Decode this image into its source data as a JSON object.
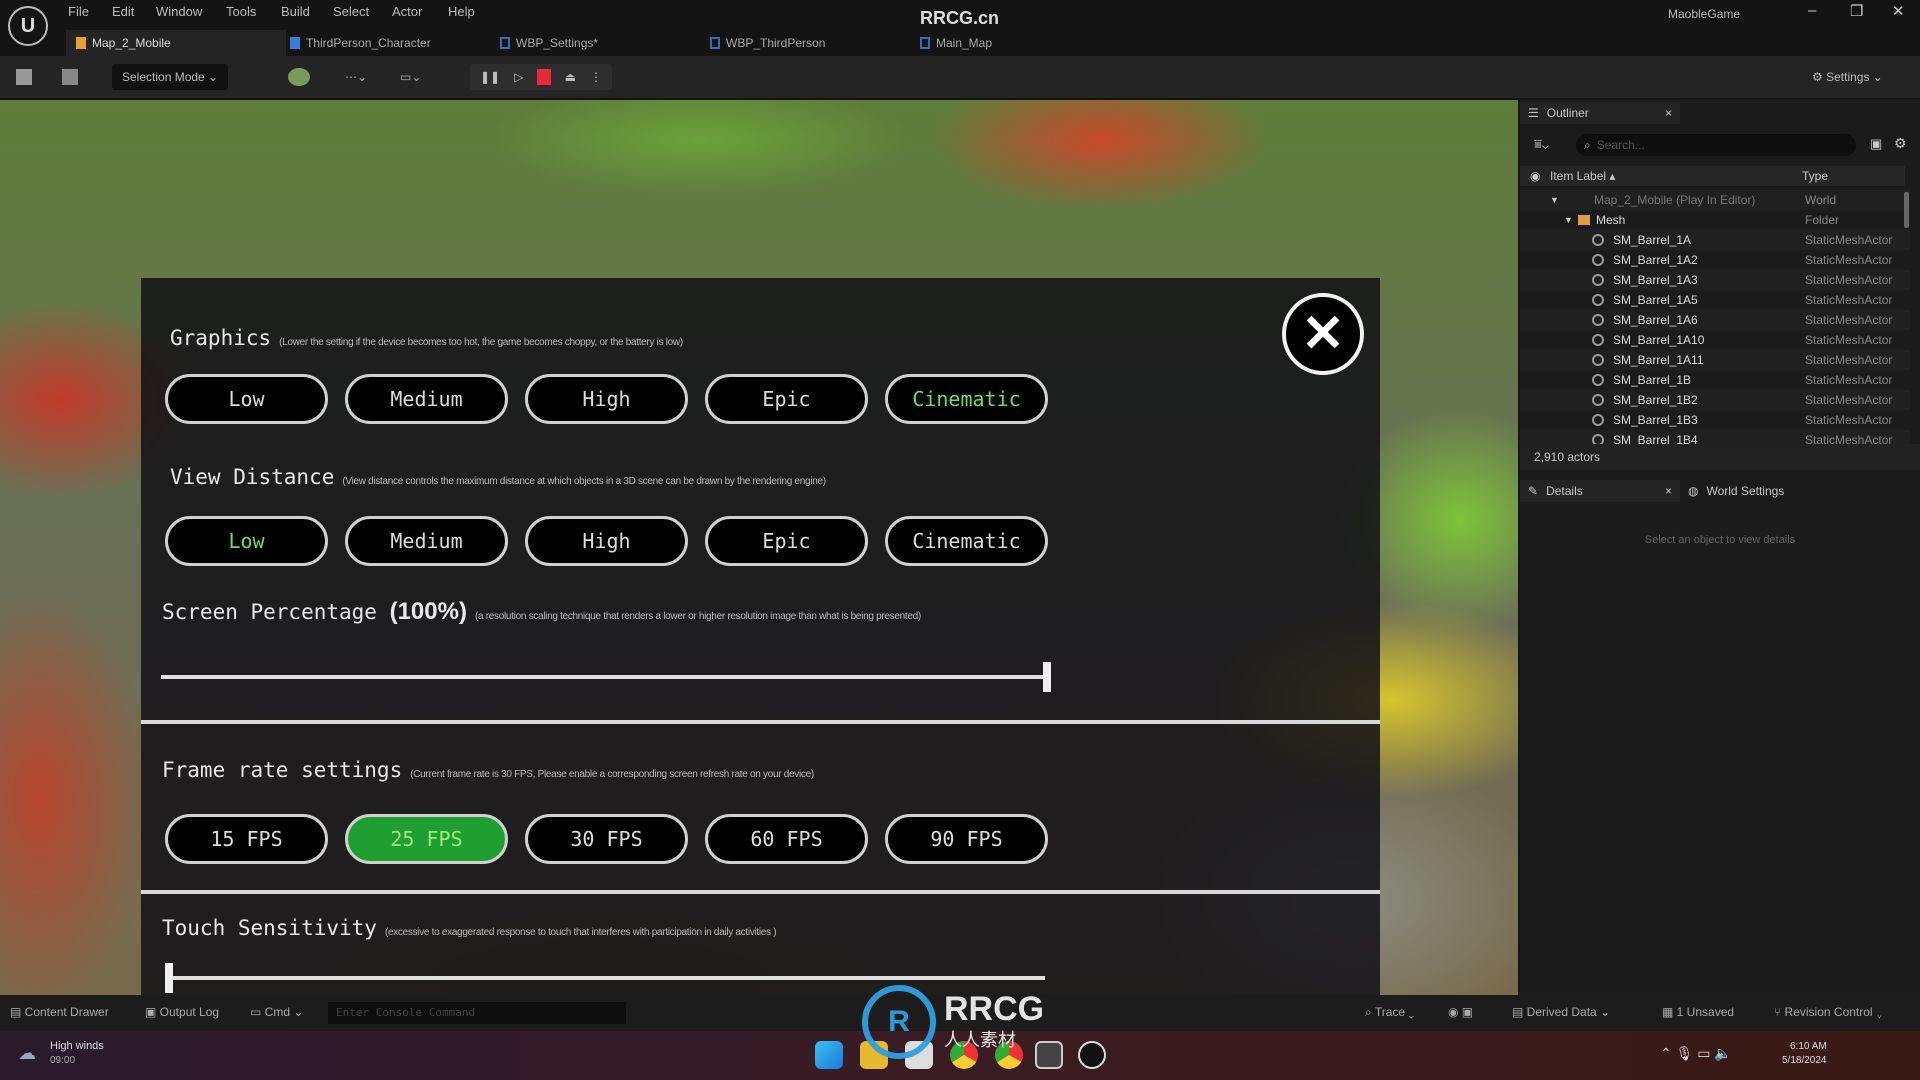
{
  "window": {
    "title": "RRCG.cn",
    "project": "MaobleGame",
    "minimize": "–",
    "restore": "❐",
    "close": "✕"
  },
  "menu": [
    "File",
    "Edit",
    "Window",
    "Tools",
    "Build",
    "Select",
    "Actor",
    "Help"
  ],
  "tabs": [
    {
      "label": "Map_2_Mobile",
      "active": true
    },
    {
      "label": "ThirdPerson_Character"
    },
    {
      "label": "WBP_Settings*"
    },
    {
      "label": "WBP_ThirdPerson"
    },
    {
      "label": "Main_Map"
    }
  ],
  "toolbar": {
    "selection_mode": "Selection Mode ⌄",
    "settings": "Settings ⌄"
  },
  "settings_menu": {
    "graphics": {
      "title": "Graphics",
      "note": "(Lower the setting if the device becomes too hot, the game becomes choppy, or the battery is low)",
      "options": [
        "Low",
        "Medium",
        "High",
        "Epic",
        "Cinematic"
      ],
      "selected": "Cinematic"
    },
    "view_distance": {
      "title": "View Distance",
      "note": "(View distance controls the maximum distance at which objects in a 3D scene can be drawn by the rendering engine)",
      "options": [
        "Low",
        "Medium",
        "High",
        "Epic",
        "Cinematic"
      ],
      "selected": "Low"
    },
    "screen_percentage": {
      "title": "Screen Percentage",
      "value_label": "(100%)",
      "note": "(a resolution scaling technique that renders a lower or higher resolution image than what is being presented)",
      "value": 1.0
    },
    "frame_rate": {
      "title": "Frame rate settings",
      "note": "(Current frame rate is 30 FPS, Please enable a corresponding screen refresh rate on your device)",
      "options": [
        "15 FPS",
        "25 FPS",
        "30 FPS",
        "60 FPS",
        "90 FPS"
      ],
      "selected": "25 FPS"
    },
    "touch_sensitivity": {
      "title": "Touch Sensitivity",
      "note": "(excessive to exaggerated response to touch that interferes with participation in daily activities )",
      "value": 0.0
    },
    "close_icon": "close-circle-icon",
    "selected_color": "#6be05a",
    "selected_fill": "#1f9e32"
  },
  "outliner": {
    "tab": "Outliner",
    "close": "×",
    "search_placeholder": "Search...",
    "col_label": "Item Label ▴",
    "col_type": "Type",
    "rows": [
      {
        "label": "Map_2_Mobile (Play In Editor)",
        "type": "World",
        "level": 0
      },
      {
        "label": "Mesh",
        "type": "Folder",
        "level": 1
      },
      {
        "label": "SM_Barrel_1A",
        "type": "StaticMeshActor",
        "level": 2
      },
      {
        "label": "SM_Barrel_1A2",
        "type": "StaticMeshActor",
        "level": 2
      },
      {
        "label": "SM_Barrel_1A3",
        "type": "StaticMeshActor",
        "level": 2
      },
      {
        "label": "SM_Barrel_1A5",
        "type": "StaticMeshActor",
        "level": 2
      },
      {
        "label": "SM_Barrel_1A6",
        "type": "StaticMeshActor",
        "level": 2
      },
      {
        "label": "SM_Barrel_1A10",
        "type": "StaticMeshActor",
        "level": 2
      },
      {
        "label": "SM_Barrel_1A11",
        "type": "StaticMeshActor",
        "level": 2
      },
      {
        "label": "SM_Barrel_1B",
        "type": "StaticMeshActor",
        "level": 2
      },
      {
        "label": "SM_Barrel_1B2",
        "type": "StaticMeshActor",
        "level": 2
      },
      {
        "label": "SM_Barrel_1B3",
        "type": "StaticMeshActor",
        "level": 2
      },
      {
        "label": "SM_Barrel_1B4",
        "type": "StaticMeshActor",
        "level": 2
      }
    ],
    "count": "2,910 actors"
  },
  "details": {
    "tab": "Details",
    "close": "×",
    "world_tab": "World Settings",
    "empty": "Select an object to view details"
  },
  "bottombar": {
    "content_drawer": "Content Drawer",
    "output_log": "Output Log",
    "cmd": "Cmd ⌄",
    "console_placeholder": "Enter Console Command",
    "trace": "Trace ⌄",
    "derived_data": "Derived Data ⌄",
    "unsaved": "1 Unsaved",
    "revision": "Revision Control ⌄"
  },
  "taskbar": {
    "weather": "High winds",
    "weather_time": "09:00",
    "time": "6:10 AM",
    "date": "5/18/2024"
  },
  "watermark": {
    "brand": "RRCG",
    "sub": "人人素材"
  }
}
